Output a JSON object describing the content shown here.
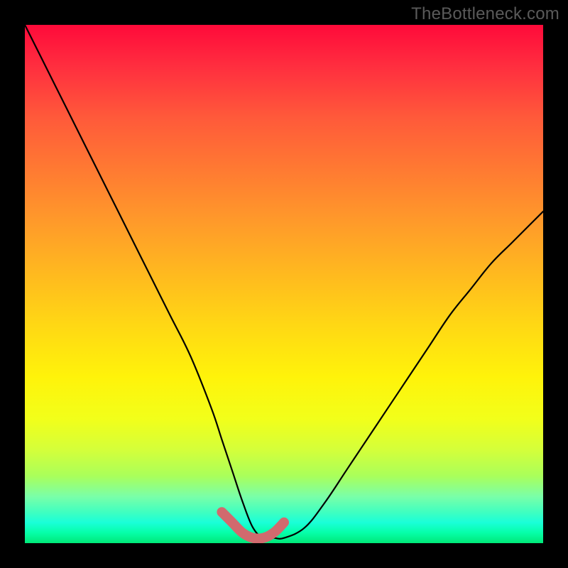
{
  "watermark": {
    "text": "TheBottleneck.com"
  },
  "colors": {
    "curve_stroke": "#000000",
    "minimum_highlight": "#d16a6e",
    "frame_bg": "#000000"
  },
  "chart_data": {
    "type": "line",
    "title": "",
    "xlabel": "",
    "ylabel": "",
    "xlim": [
      0,
      100
    ],
    "ylim": [
      0,
      100
    ],
    "grid": false,
    "series": [
      {
        "name": "bottleneck-curve",
        "x": [
          0,
          4,
          8,
          12,
          16,
          20,
          24,
          28,
          32,
          36,
          38,
          40,
          42,
          44,
          46,
          48,
          50,
          54,
          58,
          62,
          66,
          70,
          74,
          78,
          82,
          86,
          90,
          94,
          98,
          100
        ],
        "values": [
          100,
          92,
          84,
          76,
          68,
          60,
          52,
          44,
          36,
          26,
          20,
          14,
          8,
          3,
          1,
          1,
          1,
          3,
          8,
          14,
          20,
          26,
          32,
          38,
          44,
          49,
          54,
          58,
          62,
          64
        ]
      },
      {
        "name": "minimum-highlight",
        "x": [
          38,
          40,
          42,
          44,
          46,
          48,
          50
        ],
        "values": [
          6,
          4,
          2,
          1,
          1,
          2,
          4
        ]
      }
    ],
    "annotations": []
  }
}
